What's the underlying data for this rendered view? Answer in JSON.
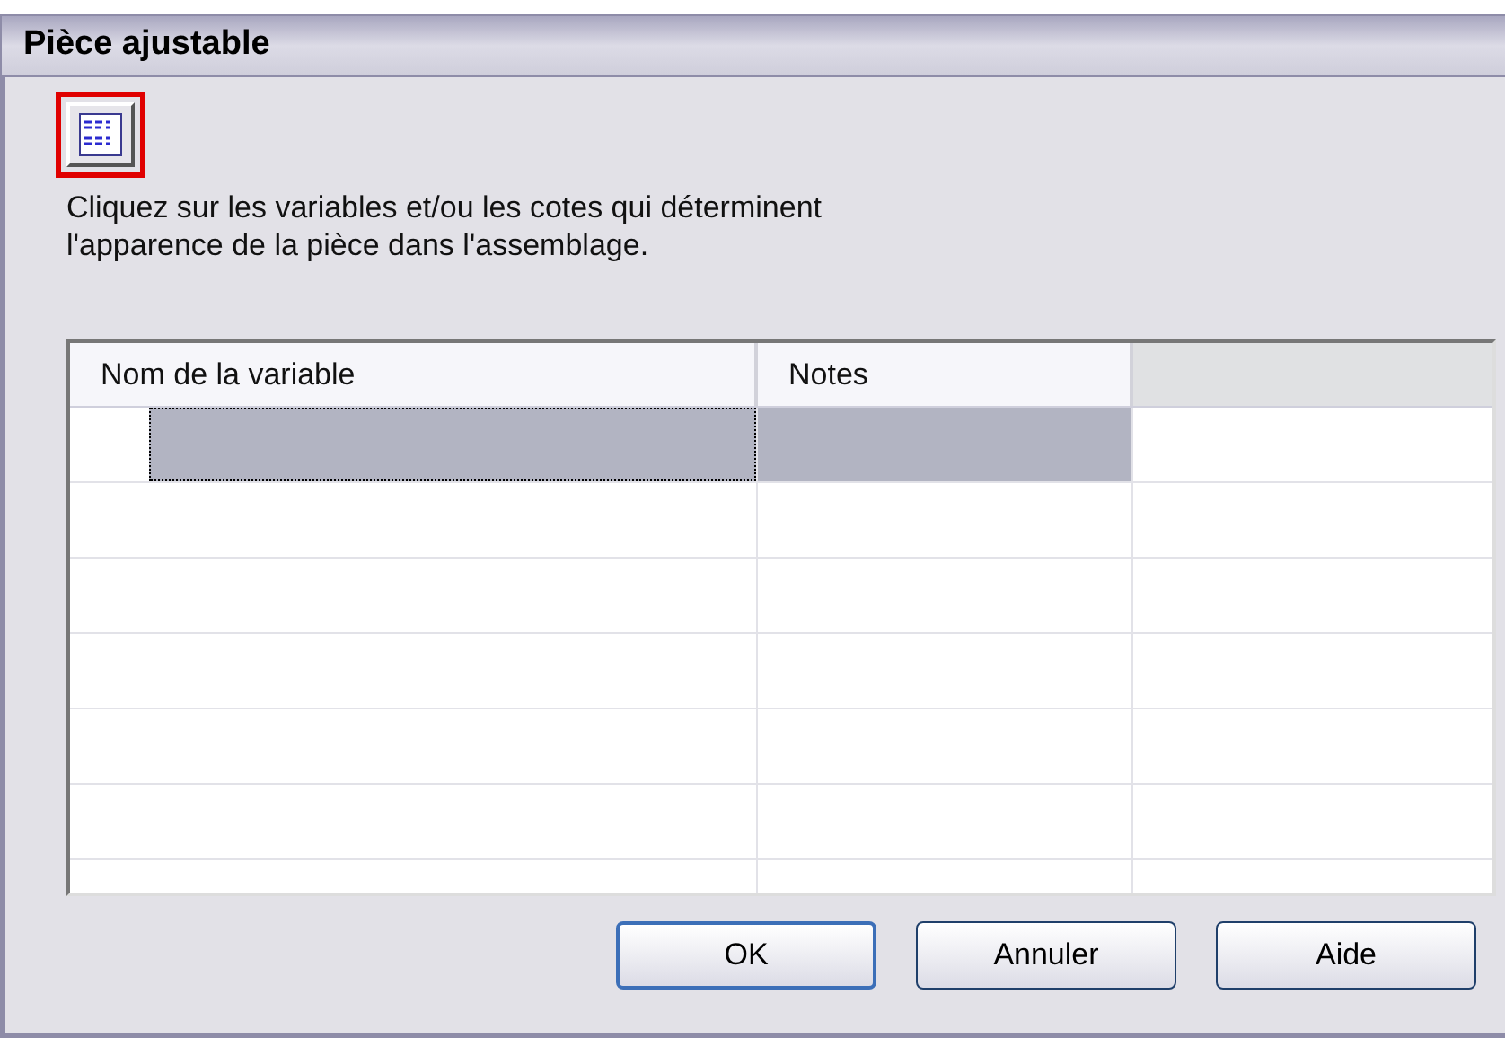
{
  "window": {
    "title": "Pièce ajustable"
  },
  "toolbar": {
    "highlighted": true
  },
  "instructions": "Cliquez sur les variables et/ou les cotes qui déterminent\nl'apparence de la pièce dans l'assemblage.",
  "table": {
    "columns": [
      "Nom de la variable",
      "Notes"
    ],
    "rows": [
      {
        "selected": true
      },
      {
        "selected": false
      },
      {
        "selected": false
      },
      {
        "selected": false
      },
      {
        "selected": false
      },
      {
        "selected": false
      },
      {
        "selected": false
      }
    ]
  },
  "buttons": [
    {
      "label": "OK",
      "default": true
    },
    {
      "label": "Annuler",
      "default": false
    },
    {
      "label": "Aide",
      "default": false
    }
  ]
}
